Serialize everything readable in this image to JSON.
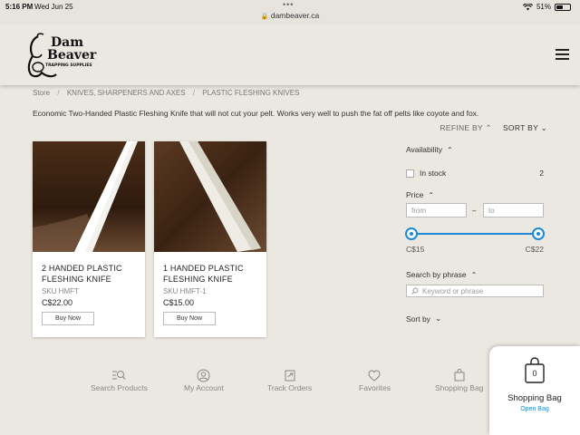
{
  "status_bar": {
    "time": "5:16 PM",
    "date": "Wed Jun 25",
    "url": "dambeaver.ca",
    "battery_percent": "51%",
    "battery_level": 0.51
  },
  "header": {
    "logo_text_line1": "Dam",
    "logo_text_line2": "Beaver",
    "logo_text_line3": "TRAPPING SUPPLIES",
    "menu_icon": "hamburger-icon"
  },
  "breadcrumb": {
    "items": [
      "Store",
      "KNIVES, SHARPENERS AND AXES",
      "PLASTIC FLESHING KNIVES"
    ],
    "separator": "/"
  },
  "description": "Economic Two-Handed Plastic Fleshing Knife that will not cut your pelt. Works very well to push the fat off pelts like coyote and fox.",
  "sort_controls": {
    "refine_by": "REFINE BY",
    "sort_by": "SORT BY"
  },
  "products": [
    {
      "title_line1": "2 HANDED PLASTIC",
      "title_line2": "FLESHING KNIFE",
      "sku": "SKU HMFT",
      "price": "C$22.00",
      "button_label": "Buy Now"
    },
    {
      "title_line1": "1 HANDED PLASTIC",
      "title_line2": "FLESHING KNIFE",
      "sku": "SKU HMFT-1",
      "price": "C$15.00",
      "button_label": "Buy Now"
    }
  ],
  "filters": {
    "availability_label": "Availability",
    "in_stock_label": "In stock",
    "in_stock_count": "2",
    "price_label": "Price",
    "from_placeholder": "from",
    "to_placeholder": "to",
    "dash": "–",
    "price_min": "C$15",
    "price_max": "C$22",
    "search_phrase_label": "Search by phrase",
    "search_placeholder": "Keyword or phrase",
    "sort_by_label": "Sort by"
  },
  "bottom_nav": [
    {
      "label": "Search Products",
      "icon": "search-list-icon"
    },
    {
      "label": "My Account",
      "icon": "user-icon"
    },
    {
      "label": "Track Orders",
      "icon": "track-orders-icon"
    },
    {
      "label": "Favorites",
      "icon": "heart-icon"
    },
    {
      "label": "Shopping Bag",
      "icon": "bag-icon"
    }
  ],
  "bag_panel": {
    "count": "0",
    "title": "Shopping Bag",
    "link": "Open Bag"
  },
  "colors": {
    "background": "#ebe8e2",
    "accent": "#1e88d4"
  }
}
